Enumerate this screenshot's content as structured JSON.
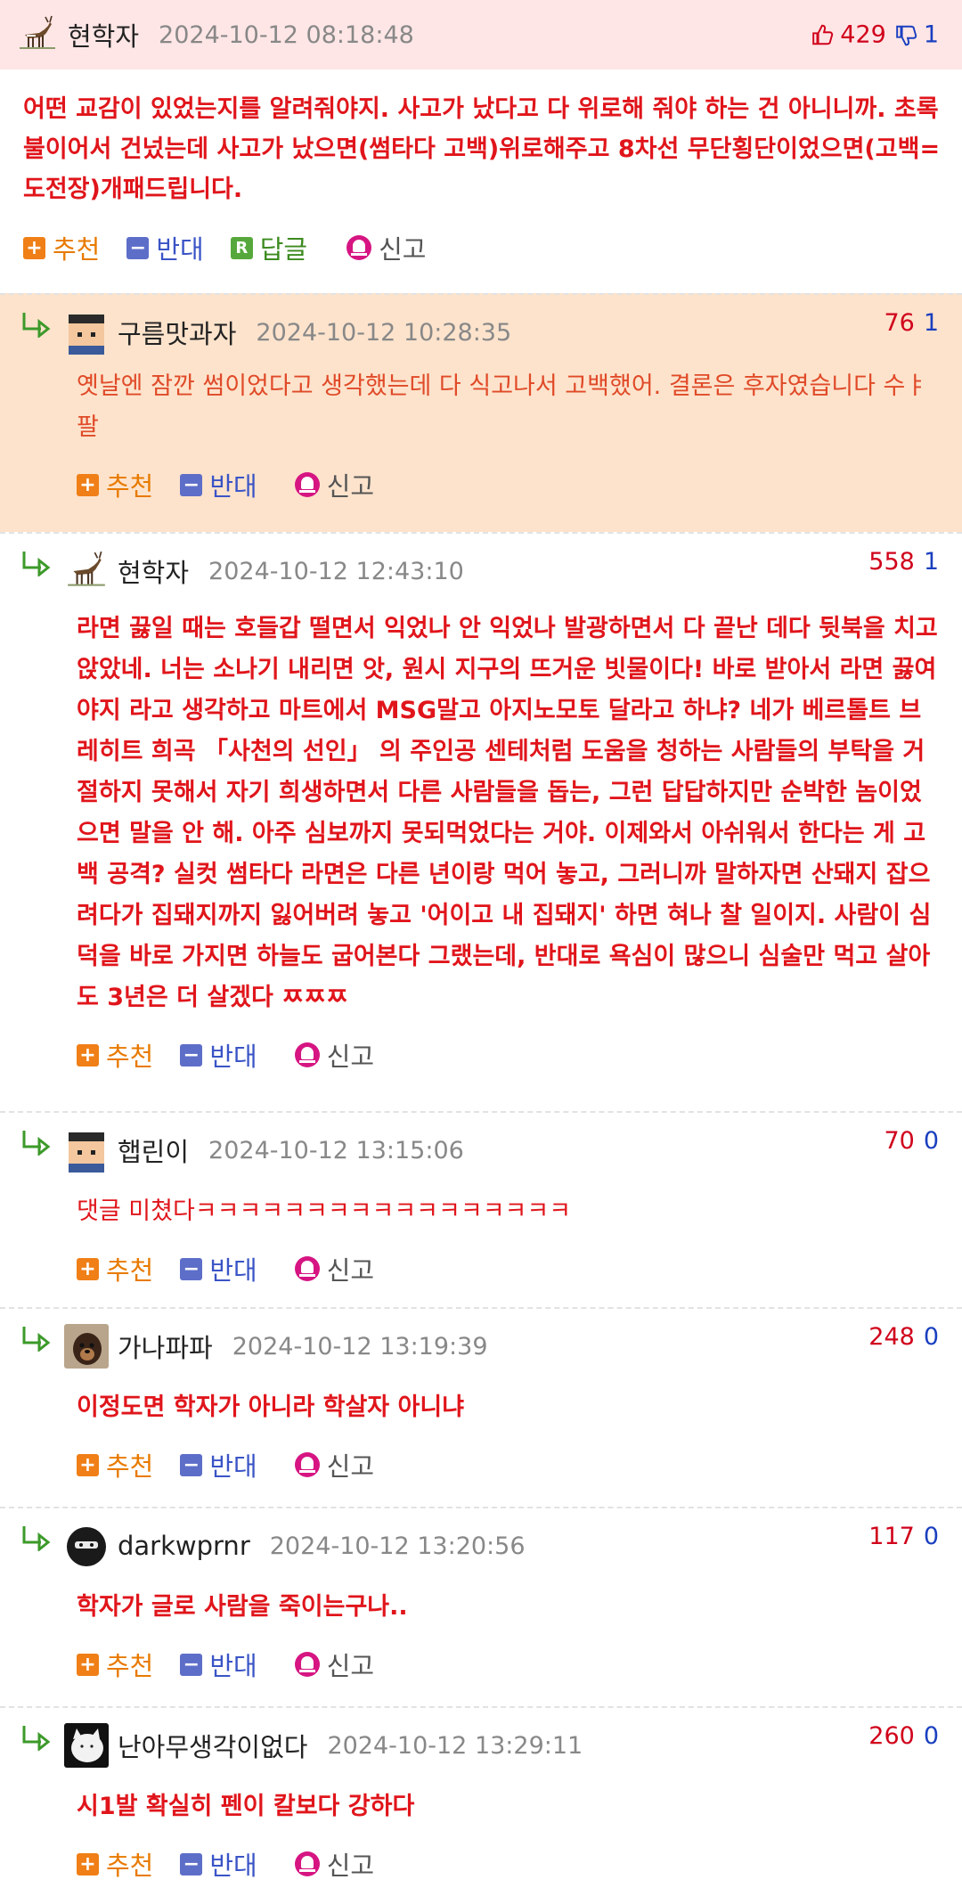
{
  "main": {
    "nick": "현학자",
    "time": "2024-10-12 08:18:48",
    "up": "429",
    "down": "1",
    "body": "어떤 교감이 있었는지를 알려줘야지. 사고가 났다고 다 위로해 줘야 하는 건 아니니까. 초록불이어서 건넜는데 사고가 났으면(썸타다 고백)위로해주고 8차선 무단횡단이었으면(고백=도전장)개패드립니다.",
    "actions": {
      "up": "추천",
      "down": "반대",
      "reply": "답글",
      "report": "신고"
    }
  },
  "replies": [
    {
      "nick": "구름맛과자",
      "time": "2024-10-12 10:28:35",
      "up": "76",
      "down": "1",
      "body": "옛날엔 잠깐 썸이었다고 생각했는데 다 식고나서 고백했어. 결론은 후자였습니다 수ㅑ팔"
    },
    {
      "nick": "현학자",
      "time": "2024-10-12 12:43:10",
      "up": "558",
      "down": "1",
      "body": "라면 끓일 때는 호들갑 떨면서 익었나 안 익었나 발광하면서 다 끝난 데다 뒷북을 치고 앉았네. 너는 소나기 내리면 앗, 원시 지구의 뜨거운 빗물이다! 바로 받아서 라면 끓여야지 라고 생각하고 마트에서 MSG말고 아지노모토 달라고 하냐? 네가 베르톨트 브레히트 희곡 「사천의 선인」 의 주인공 센테처럼 도움을 청하는 사람들의 부탁을 거절하지 못해서 자기 희생하면서 다른 사람들을 돕는, 그런 답답하지만 순박한 놈이었으면 말을 안 해. 아주 심보까지 못되먹었다는 거야. 이제와서 아쉬워서 한다는 게 고백 공격? 실컷 썸타다 라면은 다른 년이랑 먹어 놓고, 그러니까 말하자면 산돼지 잡으려다가 집돼지까지 잃어버려 놓고 '어이고 내 집돼지' 하면 혀나 찰 일이지. 사람이 심덕을 바로 가지면 하늘도 굽어본다 그랬는데, 반대로 욕심이 많으니 심술만 먹고 살아도 3년은 더 살겠다 ㅉㅉㅉ"
    },
    {
      "nick": "햅린이",
      "time": "2024-10-12 13:15:06",
      "up": "70",
      "down": "0",
      "body": "댓글 미쳤다ㅋㅋㅋㅋㅋㅋㅋㅋㅋㅋㅋㅋㅋㅋㅋㅋㅋ"
    },
    {
      "nick": "가나파파",
      "time": "2024-10-12 13:19:39",
      "up": "248",
      "down": "0",
      "body": "이정도면 학자가 아니라 학살자 아니냐"
    },
    {
      "nick": "darkwprnr",
      "time": "2024-10-12 13:20:56",
      "up": "117",
      "down": "0",
      "body": "학자가 글로 사람을 죽이는구나.."
    },
    {
      "nick": "난아무생각이없다",
      "time": "2024-10-12 13:29:11",
      "up": "260",
      "down": "0",
      "body": "시1발 확실히 펜이 칼보다 강하다"
    }
  ],
  "reply_actions": {
    "up": "추천",
    "down": "반대",
    "report": "신고"
  },
  "icons": {
    "thumbs_up": "thumbs-up-icon",
    "thumbs_down": "thumbs-down-icon",
    "reply_arrow": "reply-arrow-icon"
  },
  "colors": {
    "highlight_bg": "#fde3cc",
    "main_header_bg": "#ffe6e6",
    "body_red": "#e0151b"
  }
}
